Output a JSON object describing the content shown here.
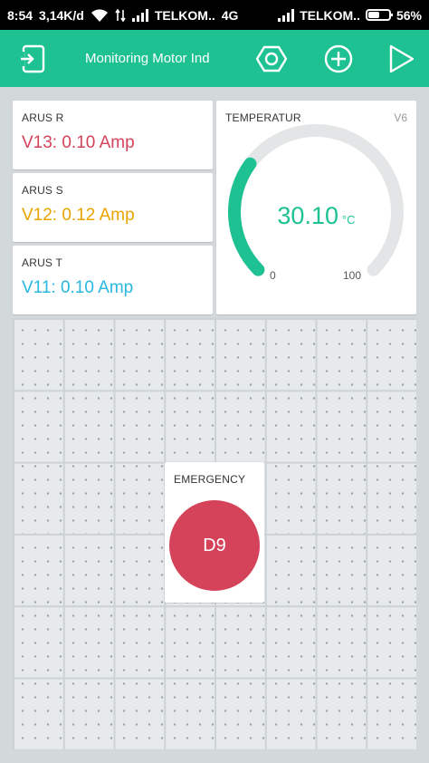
{
  "status_bar": {
    "time": "8:54",
    "speed": "3,14K/d",
    "carrier1": "TELKOM..",
    "network": "4G",
    "carrier2": "TELKOM..",
    "battery": "56%",
    "battery_level": 0.56
  },
  "app_bar": {
    "title": "Monitoring Motor Ind"
  },
  "colors": {
    "accent": "#1ec292",
    "arus_r": "#d5435b",
    "arus_s": "#e9a400",
    "arus_t": "#29b8e0",
    "button": "#d5435b"
  },
  "widgets": {
    "arus_r": {
      "label": "ARUS R",
      "value": "V13: 0.10 Amp"
    },
    "arus_s": {
      "label": "ARUS S",
      "value": "V12: 0.12 Amp"
    },
    "arus_t": {
      "label": "ARUS T",
      "value": "V11: 0.10 Amp"
    },
    "gauge": {
      "label": "TEMPERATUR",
      "pin": "V6",
      "value": "30.10",
      "unit": "°C",
      "min": "0",
      "max": "100",
      "fraction": 0.301
    },
    "emergency": {
      "label": "EMERGENCY",
      "button_label": "D9"
    }
  }
}
